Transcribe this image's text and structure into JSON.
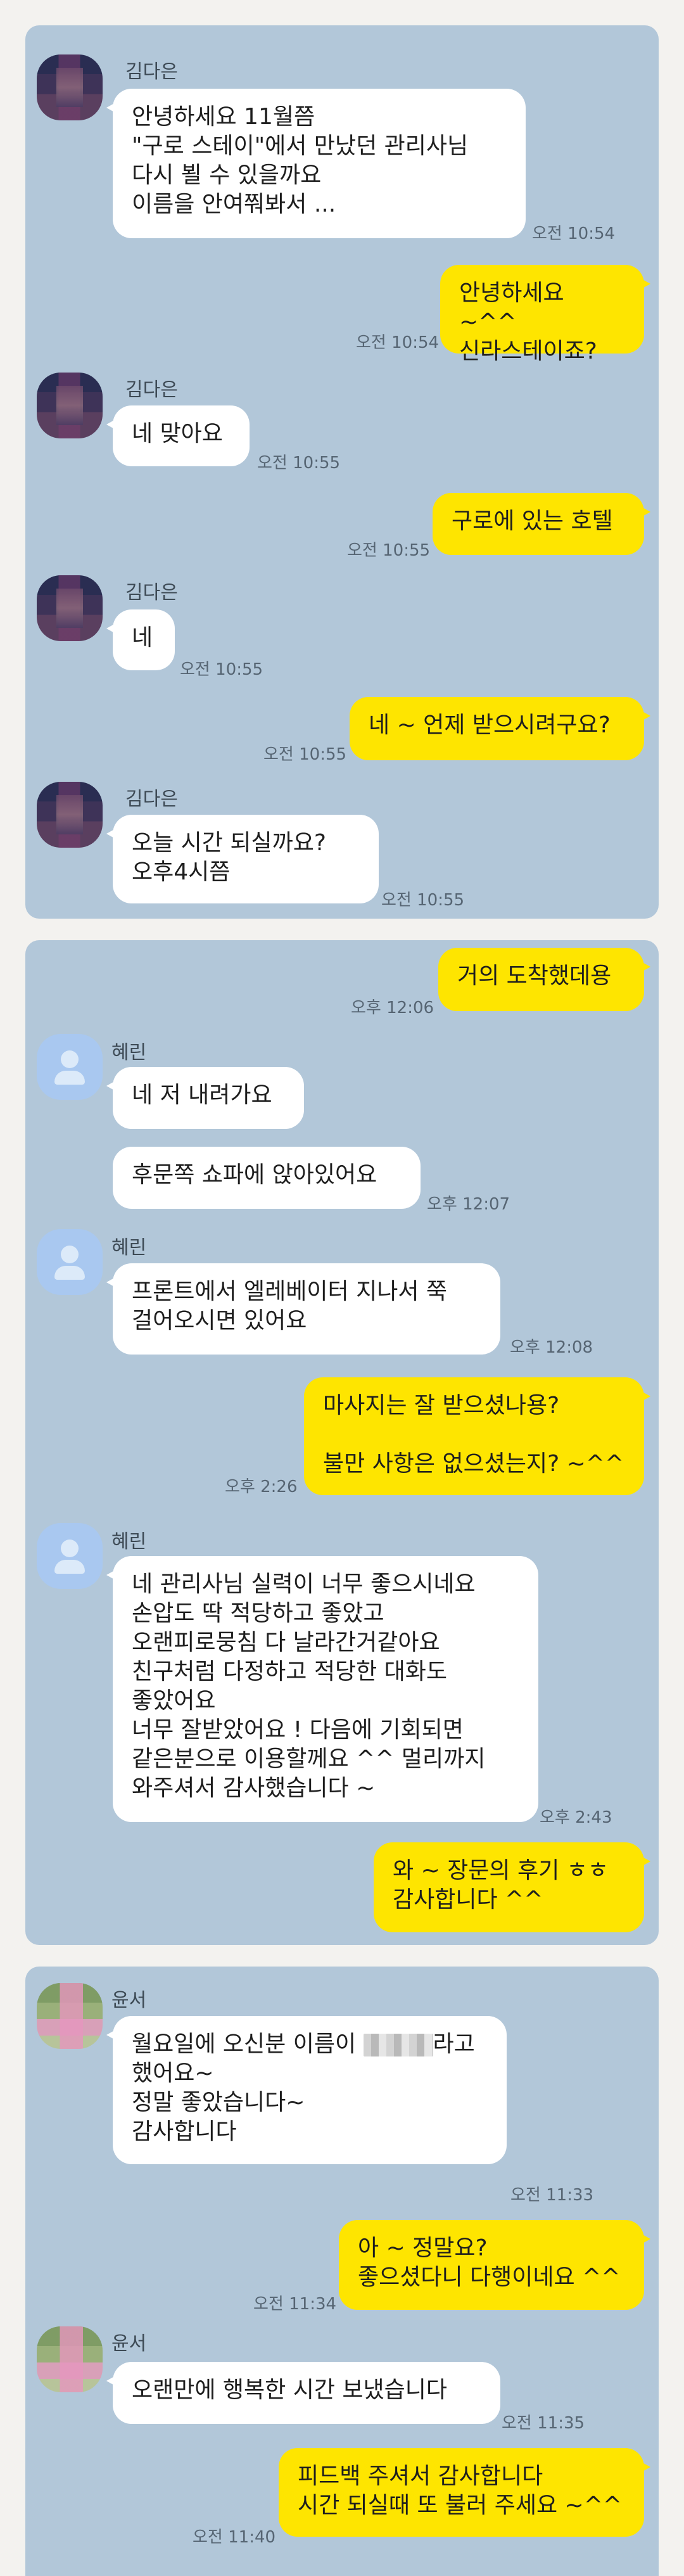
{
  "chat1": {
    "msg1": {
      "sender": "김다은",
      "text": "안녕하세요 11월쯤\n\"구로 스테이\"에서 만났던 관리사님\n다시 뵐 수 있을까요\n이름을 안여쭤봐서 ...",
      "time": "오전 10:54"
    },
    "msg2": {
      "text": "안녕하세요 ~^^\n신라스테이죠?",
      "time": "오전 10:54"
    },
    "msg3": {
      "sender": "김다은",
      "text": "네 맞아요",
      "time": "오전 10:55"
    },
    "msg4": {
      "text": "구로에 있는 호텔",
      "time": "오전 10:55"
    },
    "msg5": {
      "sender": "김다은",
      "text": "네",
      "time": "오전 10:55"
    },
    "msg6": {
      "text": "네 ~ 언제 받으시려구요?",
      "time": "오전 10:55"
    },
    "msg7": {
      "sender": "김다은",
      "text": "오늘  시간 되실까요?\n오후4시쯤",
      "time": "오전 10:55"
    }
  },
  "chat2": {
    "msg1": {
      "text": "거의 도착했데용",
      "time": "오후 12:06"
    },
    "msg2": {
      "sender": "혜린",
      "text": "네 저 내려가요"
    },
    "msg3": {
      "text": "후문쪽 쇼파에 앉아있어요",
      "time": "오후 12:07"
    },
    "msg4": {
      "sender": "혜린",
      "text": "프론트에서 엘레베이터 지나서 쭉\n걸어오시면 있어요",
      "time": "오후 12:08"
    },
    "msg5": {
      "text": "마사지는 잘 받으셨나용?\n\n불만 사항은 없으셨는지? ~^^",
      "time": "오후 2:26"
    },
    "msg6": {
      "sender": "혜린",
      "text": "네 관리사님 실력이 너무 좋으시네요\n손압도 딱 적당하고 좋았고\n오랜피로뭉침 다 날라간거같아요\n친구처럼 다정하고 적당한 대화도\n좋았어요\n너무 잘받았어요 ! 다음에 기회되면\n같은분으로 이용할께요 ^^ 멀리까지\n와주셔서 감사했습니다 ~",
      "time": "오후 2:43"
    },
    "msg7": {
      "text": "와 ~ 장문의 후기 ㅎㅎ\n감사합니다 ^^"
    }
  },
  "chat3": {
    "msg1": {
      "sender": "윤서",
      "text_before": "월요일에 오신분 이름이 ",
      "text_after": "라고\n했어요~\n정말 좋았습니다~\n감사합니다",
      "time": "오전 11:33"
    },
    "msg2": {
      "text": "아 ~ 정말요?\n좋으셨다니 다행이네요 ^^",
      "time": "오전 11:34"
    },
    "msg3": {
      "sender": "윤서",
      "text": "오랜만에 행복한 시간 보냈습니다",
      "time": "오전 11:35"
    },
    "msg4": {
      "text": "피드백 주셔서 감사합니다\n시간 되실때 또 불러 주세요 ~^^",
      "time": "오전 11:40"
    }
  }
}
